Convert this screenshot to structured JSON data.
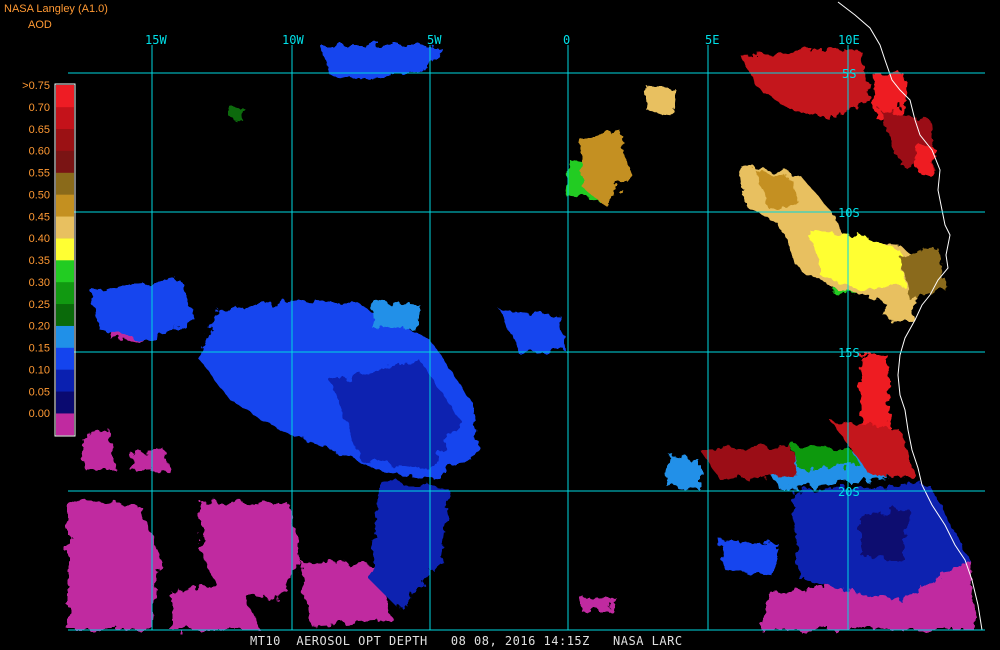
{
  "header": {
    "brand": "NASA Langley (A1.0)",
    "variable": "AOD"
  },
  "colorbar": {
    "labels": [
      ">0.75",
      "0.70",
      "0.65",
      "0.60",
      "0.55",
      "0.50",
      "0.45",
      "0.40",
      "0.35",
      "0.30",
      "0.25",
      "0.20",
      "0.15",
      "0.10",
      "0.05",
      "0.00"
    ],
    "colors": [
      "#ee1c24",
      "#c4121a",
      "#9b1114",
      "#7a1414",
      "#8a6a1a",
      "#c49020",
      "#e8c060",
      "#ffff33",
      "#22cc22",
      "#119911",
      "#0a6a0a",
      "#2090e8",
      "#1444ee",
      "#0a20b0",
      "#0a0a70",
      "#c02aa0"
    ]
  },
  "grid": {
    "lon_labels": [
      "15W",
      "10W",
      "5W",
      "0",
      "5E",
      "10E"
    ],
    "lat_labels": [
      "5S",
      "10S",
      "15S",
      "20S"
    ],
    "line_color": "#00d8e0"
  },
  "footer": {
    "text": "MT10  AEROSOL OPT DEPTH   08 08, 2016 14:15Z   NASA LARC"
  }
}
